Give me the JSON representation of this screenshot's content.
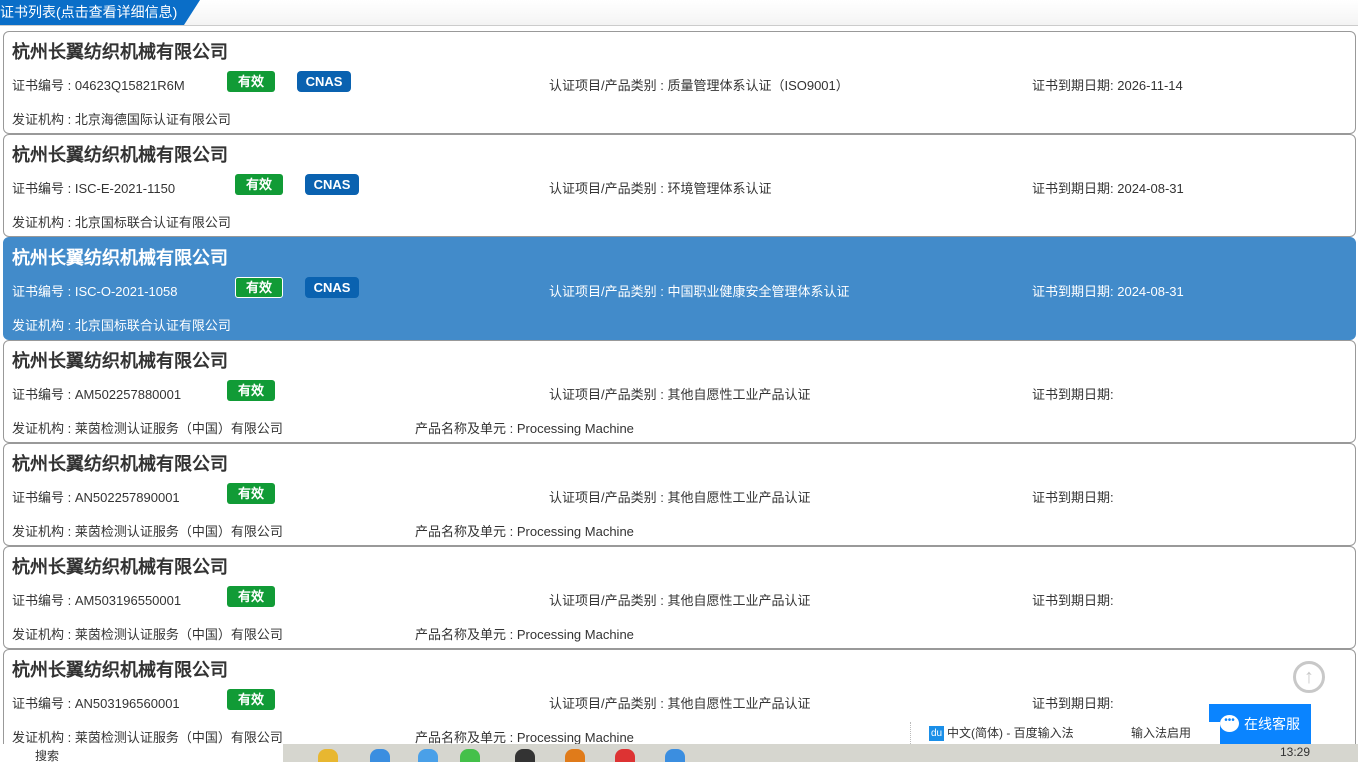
{
  "header": {
    "title": "证书列表(点击查看详细信息)"
  },
  "labels": {
    "no": "证书编号 : ",
    "cat": "认证项目/产品类别 : ",
    "exp": "证书到期日期: ",
    "org": "发证机构 : ",
    "prod": "产品名称及单元 : "
  },
  "certs": [
    {
      "company": "杭州长翼纺织机械有限公司",
      "no": "04623Q15821R6M",
      "status": "有效",
      "cnas": "CNAS",
      "category": "质量管理体系认证（ISO9001）",
      "expiry": "2026-11-14",
      "org": "北京海德国际认证有限公司",
      "product": ""
    },
    {
      "company": "杭州长翼纺织机械有限公司",
      "no": "ISC-E-2021-1150",
      "status": "有效",
      "cnas": "CNAS",
      "category": "环境管理体系认证",
      "expiry": "2024-08-31",
      "org": "北京国标联合认证有限公司",
      "product": ""
    },
    {
      "company": "杭州长翼纺织机械有限公司",
      "no": "ISC-O-2021-1058",
      "status": "有效",
      "cnas": "CNAS",
      "category": "中国职业健康安全管理体系认证",
      "expiry": "2024-08-31",
      "org": "北京国标联合认证有限公司",
      "product": "",
      "selected": true
    },
    {
      "company": "杭州长翼纺织机械有限公司",
      "no": "AM502257880001",
      "status": "有效",
      "category": "其他自愿性工业产品认证",
      "expiry": "",
      "org": "莱茵检测认证服务（中国）有限公司",
      "product": "Processing Machine"
    },
    {
      "company": "杭州长翼纺织机械有限公司",
      "no": "AN502257890001",
      "status": "有效",
      "category": "其他自愿性工业产品认证",
      "expiry": "",
      "org": "莱茵检测认证服务（中国）有限公司",
      "product": "Processing Machine"
    },
    {
      "company": "杭州长翼纺织机械有限公司",
      "no": "AM503196550001",
      "status": "有效",
      "category": "其他自愿性工业产品认证",
      "expiry": "",
      "org": "莱茵检测认证服务（中国）有限公司",
      "product": "Processing Machine"
    },
    {
      "company": "杭州长翼纺织机械有限公司",
      "no": "AN503196560001",
      "status": "有效",
      "category": "其他自愿性工业产品认证",
      "expiry": "",
      "org": "莱茵检测认证服务（中国）有限公司",
      "product": "Processing Machine"
    }
  ],
  "widgets": {
    "chat": "在线客服",
    "ime_lang": "中文(简体) - 百度输入法",
    "ime_state": "输入法启用",
    "ime_du": "du"
  },
  "taskbar": {
    "search": "搜索",
    "clock": "13:29"
  }
}
